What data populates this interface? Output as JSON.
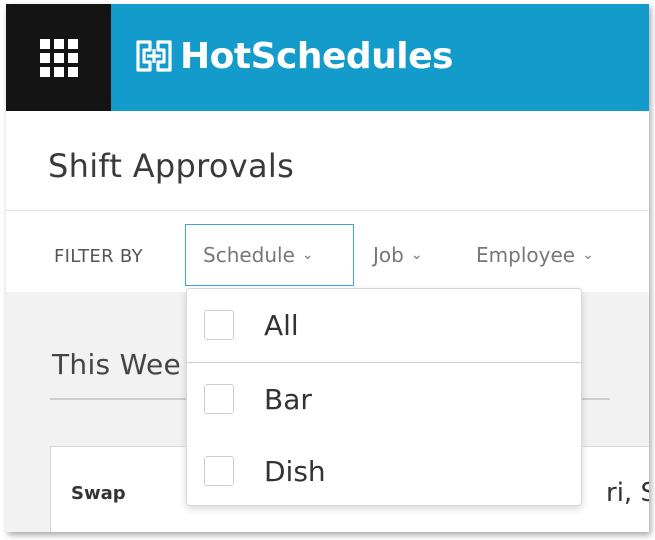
{
  "header": {
    "brand_name": "HotSchedules",
    "brand_color": "#139ccb",
    "apps_icon": "grid-apps-icon"
  },
  "page": {
    "title": "Shift Approvals"
  },
  "filters": {
    "label": "FILTER BY",
    "items": [
      {
        "label": "Schedule",
        "icon": "chevron-down-icon",
        "active": true
      },
      {
        "label": "Job",
        "icon": "chevron-down-icon",
        "active": false
      },
      {
        "label": "Employee",
        "icon": "chevron-down-icon",
        "active": false
      }
    ]
  },
  "schedule_dropdown": {
    "options": [
      {
        "label": "All",
        "checked": false
      },
      {
        "label": "Bar",
        "checked": false
      },
      {
        "label": "Dish",
        "checked": false
      }
    ]
  },
  "content": {
    "week_label": "This Wee",
    "card": {
      "type_label": "Swap",
      "date_label": "ri, Sep"
    }
  },
  "chevron_glyph": "⌄"
}
